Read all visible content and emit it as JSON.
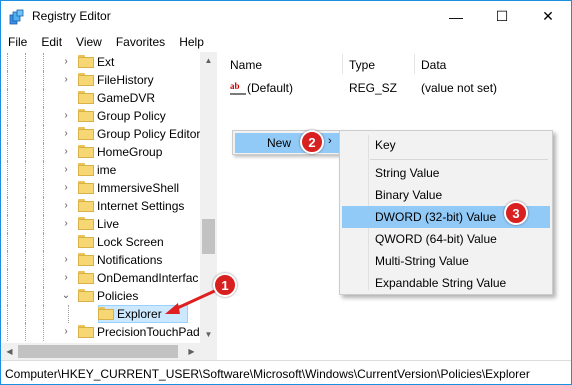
{
  "window": {
    "title": "Registry Editor",
    "minimize_glyph": "—",
    "maximize_glyph": "☐",
    "close_glyph": "✕"
  },
  "menubar": [
    "File",
    "Edit",
    "View",
    "Favorites",
    "Help"
  ],
  "tree": {
    "items": [
      {
        "label": "Ext",
        "expandable": true
      },
      {
        "label": "FileHistory",
        "expandable": true
      },
      {
        "label": "GameDVR",
        "expandable": false
      },
      {
        "label": "Group Policy",
        "expandable": true
      },
      {
        "label": "Group Policy Editor",
        "expandable": true
      },
      {
        "label": "HomeGroup",
        "expandable": true
      },
      {
        "label": "ime",
        "expandable": true
      },
      {
        "label": "ImmersiveShell",
        "expandable": true
      },
      {
        "label": "Internet Settings",
        "expandable": true
      },
      {
        "label": "Live",
        "expandable": true
      },
      {
        "label": "Lock Screen",
        "expandable": false
      },
      {
        "label": "Notifications",
        "expandable": true
      },
      {
        "label": "OnDemandInterfac",
        "expandable": true
      },
      {
        "label": "Policies",
        "expandable": true,
        "expanded": true
      },
      {
        "label": "Explorer",
        "expandable": false,
        "selected": true,
        "child": true
      },
      {
        "label": "PrecisionTouchPad",
        "expandable": true
      }
    ]
  },
  "list": {
    "headers": {
      "name": "Name",
      "type": "Type",
      "data": "Data"
    },
    "rows": [
      {
        "name": "(Default)",
        "type": "REG_SZ",
        "data": "(value not set)",
        "icon": "ab"
      }
    ]
  },
  "context_menu": {
    "new_label": "New",
    "arrow": "›"
  },
  "submenu": {
    "key": "Key",
    "items": [
      "String Value",
      "Binary Value",
      "DWORD (32-bit) Value",
      "QWORD (64-bit) Value",
      "Multi-String Value",
      "Expandable String Value"
    ],
    "highlighted": "DWORD (32-bit) Value"
  },
  "badges": [
    "1",
    "2",
    "3"
  ],
  "statusbar": {
    "path": "Computer\\HKEY_CURRENT_USER\\Software\\Microsoft\\Windows\\CurrentVersion\\Policies\\Explorer"
  },
  "colors": {
    "highlight": "#91c9f7",
    "badge": "#d92020",
    "selection": "#cce8ff",
    "folder": "#f7d774"
  }
}
